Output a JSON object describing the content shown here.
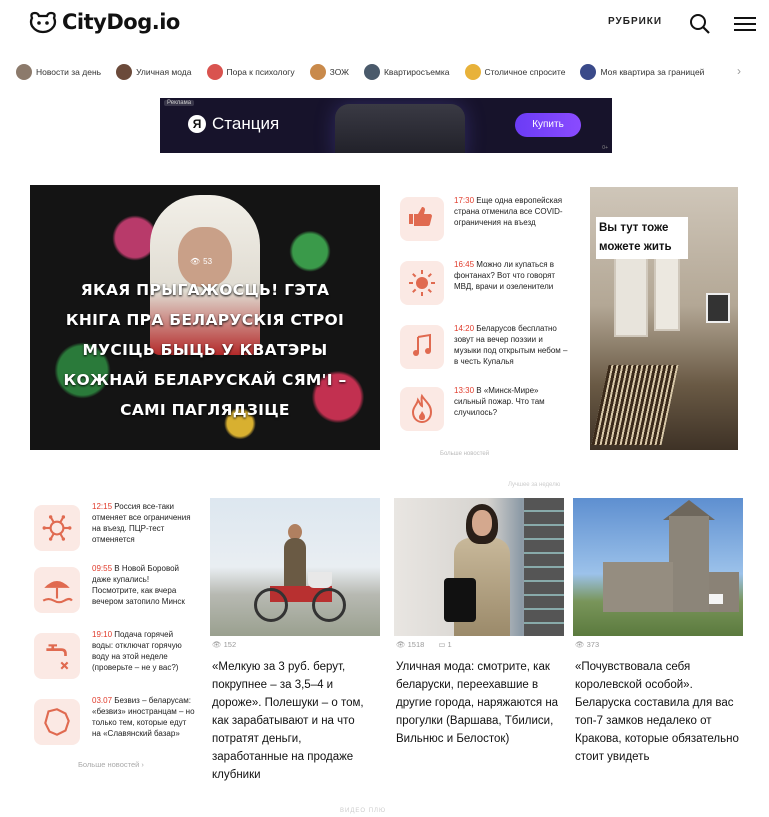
{
  "header": {
    "logo_text": "CityDog.io",
    "rubrics_label": "РУБРИКИ",
    "search_icon": "search-icon",
    "menu_icon": "hamburger-menu-icon"
  },
  "tags": [
    {
      "label": "Новости за день",
      "color": "#8c7a6b"
    },
    {
      "label": "Уличная мода",
      "color": "#6b4a3a"
    },
    {
      "label": "Пора к психологу",
      "color": "#d9534f"
    },
    {
      "label": "ЗОЖ",
      "color": "#c98a4b"
    },
    {
      "label": "Квартиросъемка",
      "color": "#4a5a6b"
    },
    {
      "label": "Столичное спросите",
      "color": "#e8b23a"
    },
    {
      "label": "Моя квартира за границей",
      "color": "#3a4a8a"
    }
  ],
  "ad": {
    "label": "Реклама",
    "brand_letter": "Я",
    "title": "Станция",
    "button_label": "Купить",
    "disclaimer": "0+"
  },
  "feature": {
    "views": "53",
    "title": "ЯКАЯ ПРЫГАЖОСЦЬ! ГЭТА КНІГА ПРА БЕЛАРУСКІЯ СТРОІ МУСІЦЬ БЫЦЬ У КВАТЭРЫ КОЖНАЙ БЕЛАРУСКАЙ СЯМ'І – САМІ ПАГЛЯДЗІЦЕ"
  },
  "news_col_1": [
    {
      "time": "17:30",
      "text": "Еще одна европейская страна отменила все COVID-ограничения на въезд",
      "icon": "thumbs-up-icon"
    },
    {
      "time": "16:45",
      "text": "Можно ли купаться в фонтанах? Вот что говорят МВД, врачи и озеленители",
      "icon": "sun-icon"
    },
    {
      "time": "14:20",
      "text": "Беларусов бесплатно зовут на вечер поэзии и музыки под открытым небом – в честь Купалья",
      "icon": "music-note-icon"
    },
    {
      "time": "13:30",
      "text": "В «Минск-Мире» сильный пожар. Что там случилось?",
      "icon": "fire-icon"
    }
  ],
  "more_link_1": "Больше новостей",
  "promo": {
    "label": "Вы тут тоже можете жить"
  },
  "section_label_2": "Лучшее за неделю",
  "news_col_2": [
    {
      "time": "12:15",
      "text": "Россия все-таки отменяет все ограничения на въезд. ПЦР-тест отменяется",
      "icon": "virus-icon"
    },
    {
      "time": "09:55",
      "text": "В Новой Боровой даже купались! Посмотрите, как вчера вечером затопило Минск",
      "icon": "beach-umbrella-icon"
    },
    {
      "time": "19:10",
      "text": "Подача горячей воды: отключат горячую воду на этой неделе (проверьте – не у вас?)",
      "icon": "faucet-icon"
    },
    {
      "time": "03.07",
      "text": "Безвиз – беларусам: «безвиз» иностранцам – но только тем, которые едут на «Славянский базар»",
      "icon": "belarus-map-icon"
    }
  ],
  "more_news": "Больше новостей",
  "cards": [
    {
      "views": "152",
      "comments": "",
      "title": "«Мелкую за 3 руб. берут, покрупнее – за 3,5–4 и дороже». Полешуки – о том, как зарабатывают и на что потратят деньги, заработанные на продаже клубники",
      "image": "man-with-bicycle"
    },
    {
      "views": "1518",
      "comments": "1",
      "title": "Уличная мода: смотрите, как беларуски, переехавшие в другие города, наряжаются на прогулки (Варшава, Тбилиси, Вильнюс и Белосток)",
      "image": "woman-in-coat"
    },
    {
      "views": "373",
      "comments": "",
      "title": "«Почувствовала себя королевской особой». Беларуска составила для вас топ-7 замков недалеко от Кракова, которые обязательно стоит увидеть",
      "image": "castle-tower"
    }
  ],
  "bottom_label": "ВИДЕО ПЛЮ",
  "colors": {
    "accent": "#e03b2b",
    "icon_bg": "#fbe9e4",
    "ad_bg": "#17132b",
    "ad_button": "#7a44fa"
  }
}
